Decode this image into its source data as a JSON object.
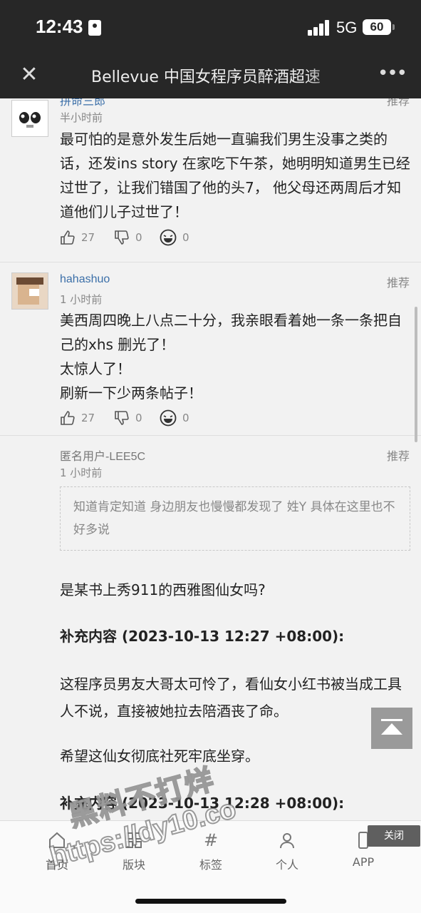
{
  "status_bar": {
    "time": "12:43",
    "network": "5G",
    "battery": "60"
  },
  "title_bar": {
    "title": "Bellevue 中国女程序员醉酒超速"
  },
  "posts": [
    {
      "username": "拼命三郎",
      "tag": "推荐",
      "time": "半小时前",
      "text": "最可怕的是意外发生后她一直骗我们男生没事之类的话，还发ins story 在家吃下午茶，她明明知道男生已经过世了，让我们错国了他的头7， 他父母还两周后才知道他们儿子过世了！",
      "likes": "27",
      "dislikes": "0",
      "laughs": "0"
    },
    {
      "username": "hahashuo",
      "tag": "推荐",
      "time": "1 小时前",
      "text_lines": [
        "美西周四晚上八点二十分，我亲眼看着她一条一条把自己的xhs 删光了！",
        "太惊人了！",
        "刷新一下少两条帖子！"
      ],
      "likes": "27",
      "dislikes": "0",
      "laughs": "0"
    },
    {
      "username": "匿名用户-LEE5C",
      "tag": "推荐",
      "time": "1 小时前",
      "quote": "知道肯定知道 身边朋友也慢慢都发现了 姓Y 具体在这里也不好多说",
      "paragraphs": [
        "是某书上秀911的西雅图仙女吗?",
        "补充内容 (2023-10-13 12:27 +08:00):",
        "这程序员男友大哥太可怜了，看仙女小红书被当成工具人不说，直接被她拉去陪酒丧了命。",
        "希望这仙女彻底社死牢底坐穿。",
        "补充内容 (2023-10-13 12:28 +08:00):"
      ]
    }
  ],
  "tab_bar": {
    "items": [
      {
        "label": "首页",
        "icon": "home-icon"
      },
      {
        "label": "版块",
        "icon": "grid-icon"
      },
      {
        "label": "标签",
        "icon": "hashtag-icon"
      },
      {
        "label": "个人",
        "icon": "person-icon"
      },
      {
        "label": "APP",
        "icon": "phone-icon"
      }
    ],
    "close_label": "关闭"
  },
  "watermark": {
    "line1": "黑料不打烊",
    "line2": "https://dy10.co"
  }
}
